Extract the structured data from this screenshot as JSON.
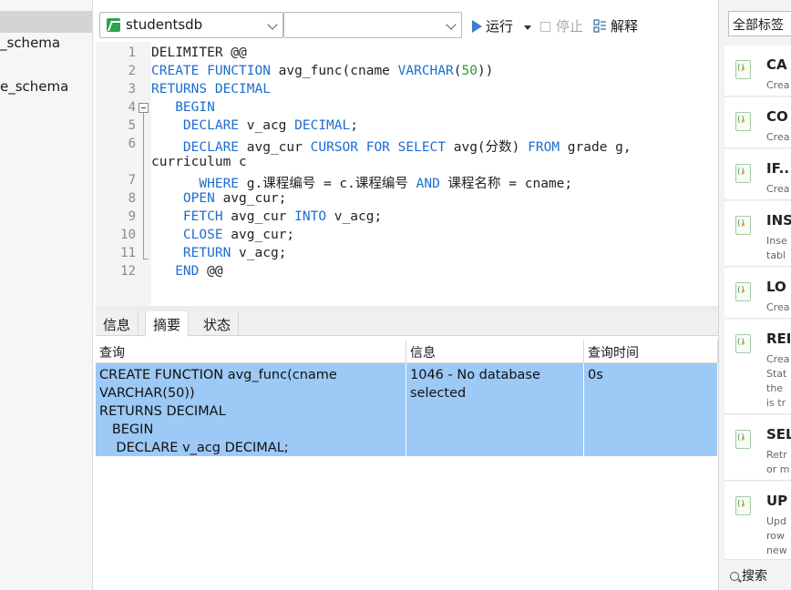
{
  "navigator": {
    "schemas": [
      "_schema",
      "e_schema"
    ]
  },
  "toolbar": {
    "database_value": "studentsdb",
    "schema_value": "",
    "run_label": "运行",
    "stop_label": "停止",
    "explain_label": "解释"
  },
  "editor": {
    "line_numbers": [
      "1",
      "2",
      "3",
      "4",
      "5",
      "6",
      "",
      "7",
      "8",
      "9",
      "10",
      "11",
      "12"
    ]
  },
  "bottom": {
    "tabs": [
      "信息",
      "摘要",
      "状态"
    ],
    "active_tab": "摘要",
    "columns": [
      "查询",
      "信息",
      "查询时间"
    ],
    "row": {
      "query": "CREATE FUNCTION avg_func(cname\nVARCHAR(50))\nRETURNS DECIMAL\n   BEGIN\n    DECLARE v_acg DECIMAL;",
      "message": "1046 - No database\nselected",
      "time": "0s"
    }
  },
  "snippets": {
    "filter_value": "全部标签",
    "items": [
      {
        "title": "CA",
        "desc": "Crea"
      },
      {
        "title": "CO",
        "desc": "Crea"
      },
      {
        "title": "IF..",
        "desc": "Crea"
      },
      {
        "title": "INS",
        "desc": "Inse\ntabl"
      },
      {
        "title": "LO",
        "desc": "Crea"
      },
      {
        "title": "REI",
        "desc": "Crea\nStat\nthe\nis tr"
      },
      {
        "title": "SEL",
        "desc": "Retr\nor m"
      },
      {
        "title": "UP",
        "desc": "Upd\nrow\nnew"
      }
    ],
    "search_label": "搜索"
  },
  "colors": {
    "keyword": "#1c6dd0",
    "number": "#2e9b2e",
    "selection": "#9cc9f5"
  }
}
